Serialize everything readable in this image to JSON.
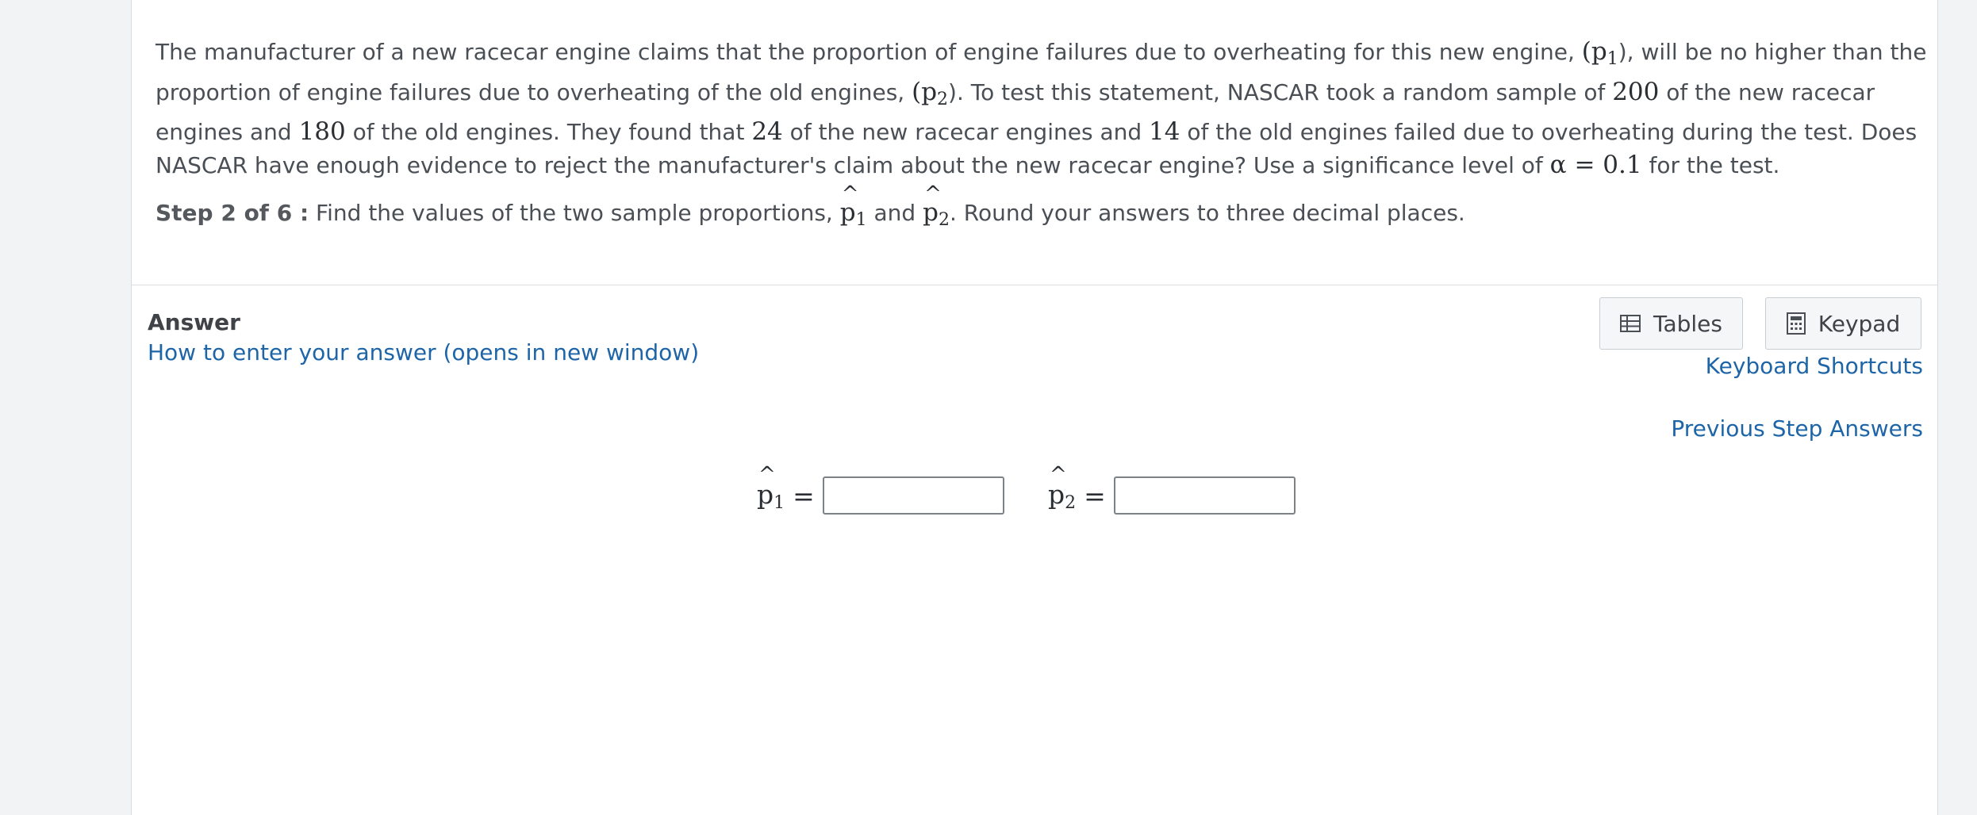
{
  "problem": {
    "seg1": "The manufacturer of a new racecar engine claims that the proportion of engine failures due to overheating for this new engine, ",
    "p1_symbol": "(p",
    "p1_sub": "1",
    "seg2": "), will be no higher than the proportion of engine failures due to overheating of the old engines, ",
    "p2_symbol": "(p",
    "p2_sub": "2",
    "seg3": ").  To test this statement, NASCAR took a random sample of ",
    "n1": "200",
    "seg4": " of the new racecar engines and ",
    "n2": "180",
    "seg5": " of the old engines.  They found that ",
    "x1": "24",
    "seg6": " of the new racecar engines and ",
    "x2": "14",
    "seg7": " of the old engines failed due to overheating during the test.  Does NASCAR have enough evidence to reject the manufacturer's claim about the new racecar engine?  Use a significance level of ",
    "alpha": "α = 0.1",
    "seg8": " for the test."
  },
  "step": {
    "label": "Step 2 of 6 :",
    "text_before": " Find the values of the two sample proportions, ",
    "phat": "p",
    "sub1": "1",
    "and": " and ",
    "sub2": "2",
    "text_after": ". Round your answers to three decimal places."
  },
  "answer": {
    "heading": "Answer",
    "how_to_link": "How to enter your answer (opens in new window)",
    "tables_label": "Tables",
    "keypad_label": "Keypad",
    "keyboard_shortcuts": "Keyboard Shortcuts",
    "previous_step_answers": "Previous Step Answers",
    "phat_symbol": "p",
    "input1_sub": "1",
    "input2_sub": "2",
    "equals": "=",
    "input1_value": "",
    "input2_value": ""
  },
  "colors": {
    "link": "#1e65a8",
    "background": "#f2f3f5",
    "panel": "#ffffff"
  }
}
